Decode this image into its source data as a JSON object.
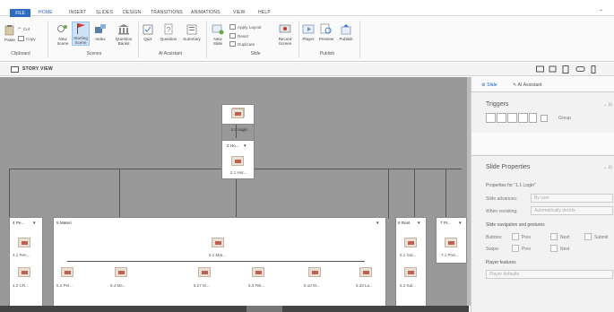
{
  "tabs": [
    "FILE",
    "HOME",
    "INSERT",
    "SLIDES",
    "DESIGN",
    "TRANSITIONS",
    "ANIMATIONS",
    "VIEW",
    "HELP"
  ],
  "active_tab": "HOME",
  "ribbon": {
    "clipboard": {
      "paste": "Paste",
      "cut": "Cut",
      "copy": "Copy",
      "label": "Clipboard"
    },
    "scenes": {
      "new_scene": "New Scene",
      "starting_scene": "Starting Scene",
      "index": "Index",
      "question_banks": "Question Banks",
      "label": "Scenes"
    },
    "ai": {
      "quiz": "Quiz",
      "question": "Question",
      "summary": "Summary",
      "label": "AI Assistant"
    },
    "slide": {
      "new_slide": "New Slide",
      "apply_layout": "Apply Layout",
      "reset": "Reset",
      "duplicate": "Duplicate",
      "record_screen": "Record Screen",
      "label": "Slide"
    },
    "publish": {
      "player": "Player",
      "preview": "Preview",
      "publish": "Publish",
      "label": "Publish"
    }
  },
  "story_view": {
    "title": "STORY VIEW"
  },
  "story": {
    "top_slide": "1.1 Login",
    "scene2": {
      "header": "2 Ho...",
      "slide": "2.1 Hot..."
    },
    "scene4": {
      "header": "4 Pe...",
      "slides": [
        "4.1 Pen...",
        "4.2 CR..."
      ]
    },
    "scene5": {
      "header": "5 Materi",
      "top": "5.1 Mat...",
      "slides": [
        "5.2 Pel...",
        "5.4 Me...",
        "5.27 M...",
        "5.3 Tek...",
        "5.10 M...",
        "5.33 La..."
      ]
    },
    "scene6": {
      "header": "6 Rant",
      "slides": [
        "6.1 Gal...",
        "6.2 Kal..."
      ]
    },
    "scene7": {
      "header": "7 Pr...",
      "slide": "7.1 Pret..."
    }
  },
  "panel": {
    "tabs": {
      "slide": "Slide",
      "ai": "AI Assistant"
    },
    "triggers": "Triggers",
    "group": "Group",
    "slide_properties": "Slide Properties",
    "properties_for": "Properties for \"1.1 Login\"",
    "slide_advances": "Slide advances:",
    "slide_advances_value": "By user",
    "when_revisiting": "When revisiting:",
    "when_revisiting_value": "Automatically decide",
    "nav_gestures": "Slide navigation and gestures",
    "buttons": "Buttons:",
    "prev": "Prev",
    "next": "Next",
    "submit": "Submit",
    "swipe": "Swipe:",
    "player_features": "Player features",
    "player_defaults": "Player defaults"
  },
  "colors": {
    "accent": "#2e6cc4",
    "canvas": "#999999"
  }
}
